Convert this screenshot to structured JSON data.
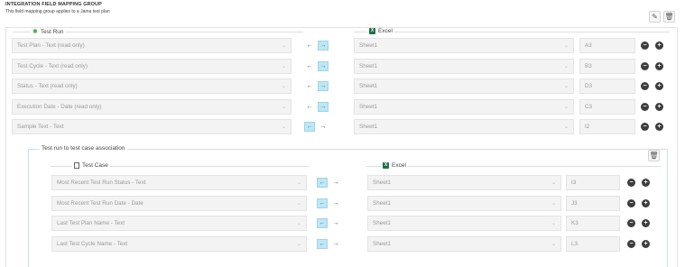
{
  "header": {
    "title": "INTEGRATION FIELD MAPPING GROUP",
    "description": "This field mapping group applies to a Jama test plan",
    "edit_icon": "edit-icon",
    "delete_icon": "trash-icon"
  },
  "left_section": {
    "label": "Test Run",
    "icon": "test-run-icon"
  },
  "right_section": {
    "label": "Excel",
    "icon": "excel-icon"
  },
  "mappings": [
    {
      "field": "Test Plan - Text (read only)",
      "direction": "right",
      "sheet": "Sheet1",
      "cell": "A3"
    },
    {
      "field": "Test Cycle - Text (read only)",
      "direction": "right",
      "sheet": "Sheet1",
      "cell": "B3"
    },
    {
      "field": "Status - Text (read only)",
      "direction": "right",
      "sheet": "Sheet1",
      "cell": "D3"
    },
    {
      "field": "Execution Date - Date (read only)",
      "direction": "right",
      "sheet": "Sheet1",
      "cell": "C3"
    },
    {
      "field": "Sample Text - Text",
      "direction": "left",
      "sheet": "Sheet1",
      "cell": "I2"
    }
  ],
  "association": {
    "label": "Test run to test case association",
    "left_label": "Test Case",
    "right_label": "Excel",
    "rows": [
      {
        "field": "Most Recent Test Run Status - Text",
        "direction": "left",
        "sheet": "Sheet1",
        "cell": "I3"
      },
      {
        "field": "Most Recent Test Run Date - Date",
        "direction": "left",
        "sheet": "Sheet1",
        "cell": "J3"
      },
      {
        "field": "Last Test Plan Name - Text",
        "direction": "left",
        "sheet": "Sheet1",
        "cell": "K3"
      },
      {
        "field": "Last Test Cycle Name - Text",
        "direction": "left",
        "sheet": "Sheet1",
        "cell": "L3"
      }
    ]
  },
  "glyphs": {
    "left_arrow": "←",
    "right_arrow": "→",
    "minus": "−",
    "plus": "+",
    "chevron": "⌄",
    "excel_letter": "X"
  },
  "colors": {
    "active_direction": "#bfe6f5",
    "inner_border": "#bfe4f0",
    "field_bg": "#f3f3f3",
    "excel_green": "#1e7145"
  }
}
